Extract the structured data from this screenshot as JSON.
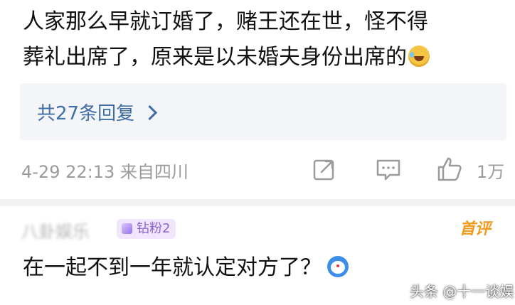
{
  "comment": {
    "text_line1": "人家那么早就订婚了，赌王还在世，怪不得",
    "text_line2": "葬礼出席了，原来是以未婚夫身份出席的",
    "emoji": "laughing-with-tears-emoji"
  },
  "replies": {
    "label": "共27条回复"
  },
  "meta": {
    "time_location": "4-29 22:13 来自四川",
    "like_count": "1万",
    "icons": [
      "share-icon",
      "comment-icon",
      "like-icon"
    ]
  },
  "second_comment": {
    "username": "八卦娱乐",
    "fan_badge": "钻粉2",
    "first_comment_badge": "首评",
    "text": "在一起不到一年就认定对方了？",
    "emoji": "robot-cat-emoji"
  },
  "watermark": "头条 @十一谈娱",
  "colors": {
    "link_blue": "#3f6ea6",
    "meta_gray": "#9b9b9b",
    "reply_bg": "#f3f5f8",
    "badge_orange": "#f29b21",
    "badge_purple": "#8a63d2"
  }
}
